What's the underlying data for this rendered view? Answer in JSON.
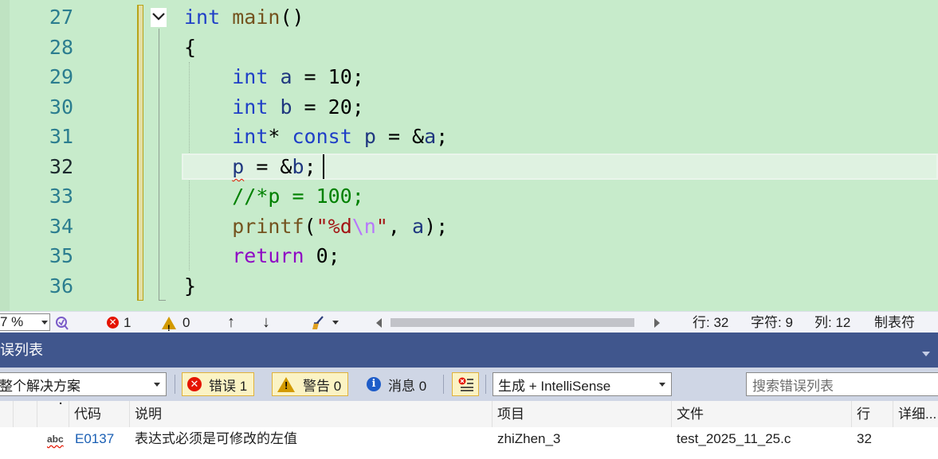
{
  "editor": {
    "line_numbers": [
      "27",
      "28",
      "29",
      "30",
      "31",
      "32",
      "33",
      "34",
      "35",
      "36"
    ],
    "current_line": "32",
    "code": {
      "l27": {
        "k": "int",
        "fn": "main",
        "rest": "()"
      },
      "l28": "{",
      "l29": {
        "k": "int",
        "id": "a",
        "op": " = ",
        "num": "10",
        "end": ";"
      },
      "l30": {
        "k": "int",
        "id": "b",
        "op": " = ",
        "num": "20",
        "end": ";"
      },
      "l31": {
        "k": "int",
        "star": "*",
        "k2": "const",
        "id": "p",
        "op": " = &",
        "id2": "a",
        "end": ";"
      },
      "l32": {
        "id": "p",
        "op": " = &",
        "id2": "b",
        "end": ";"
      },
      "l33": "//*p = 100;",
      "l34": {
        "fn": "printf",
        "open": "(",
        "str1": "\"%d",
        "esc": "\\n",
        "str2": "\"",
        "mid": ", ",
        "id": "a",
        "end": ");"
      },
      "l35": {
        "k2": "return",
        "num": "0",
        "end": ";"
      },
      "l36": "}"
    }
  },
  "statusbar": {
    "zoom": "7 %",
    "errors": "1",
    "warnings": "0",
    "line_label": "行: 32",
    "char_label": "字符: 9",
    "col_label": "列: 12",
    "tab_label": "制表符"
  },
  "error_list": {
    "title": "误列表",
    "scope": "整个解决方案",
    "errors_btn": "错误 1",
    "warnings_btn": "警告 0",
    "messages_btn": "消息 0",
    "build_filter": "生成 + IntelliSense",
    "search_placeholder": "搜索错误列表",
    "columns": {
      "code": "代码",
      "description": "说明",
      "project": "项目",
      "file": "文件",
      "line": "行",
      "details": "详细..."
    },
    "rows": [
      {
        "icon": "abc",
        "code": "E0137",
        "description": "表达式必须是可修改的左值",
        "project": "zhiZhen_3",
        "file": "test_2025_11_25.c",
        "line": "32"
      }
    ]
  },
  "colors": {
    "editor_bg": "#c7ebcb",
    "keyword": "#1f3fc7",
    "control_keyword": "#8f08c4",
    "comment": "#008000",
    "error_red": "#e51400",
    "toolwindow_header": "#40568d"
  }
}
